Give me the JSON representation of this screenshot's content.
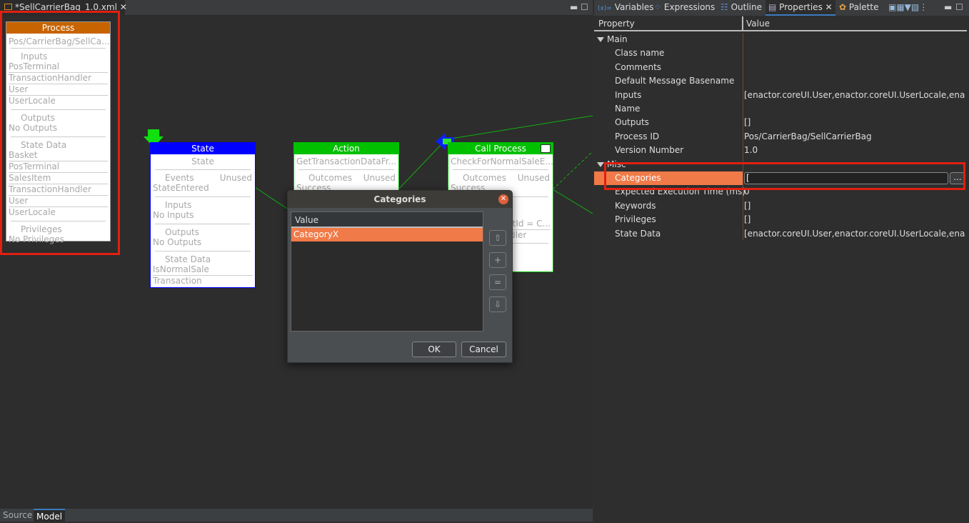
{
  "editor": {
    "tab_title": "*SellCarrierBag_1.0.xml",
    "bottom_tabs": [
      "Source",
      "Model"
    ],
    "active_bottom_tab": "Model"
  },
  "nodes": {
    "process": {
      "header": "Process",
      "header_color": "#c86400",
      "id": "Pos/CarrierBag/SellCa...",
      "inputs_label": "Inputs",
      "inputs": [
        "PosTerminal",
        "TransactionHandler",
        "User",
        "UserLocale"
      ],
      "outputs_label": "Outputs",
      "outputs_value": "No Outputs",
      "state_data_label": "State Data",
      "state_data": [
        "Basket",
        "PosTerminal",
        "SalesItem",
        "TransactionHandler",
        "User",
        "UserLocale"
      ],
      "privileges_label": "Privileges",
      "privileges_value": "No Privileges"
    },
    "state": {
      "header": "State",
      "header_color": "#0000ff",
      "name": "State",
      "events_label": "Events",
      "unused": "Unused",
      "event": "StateEntered",
      "inputs_label": "Inputs",
      "inputs_value": "No Inputs",
      "outputs_label": "Outputs",
      "outputs_value": "No Outputs",
      "state_data_label": "State Data",
      "state_data": [
        "IsNormalSale",
        "Transaction"
      ]
    },
    "action": {
      "header": "Action",
      "header_color": "#00c000",
      "name": "GetTransactionDataFr...",
      "outcomes_label": "Outcomes",
      "unused": "Unused",
      "outcome": "Success"
    },
    "call_process": {
      "header": "Call Process",
      "header_color": "#00c000",
      "name": "CheckForNormalSaleE...",
      "outcomes_label": "Outcomes",
      "unused": "Unused",
      "outcome": "Success",
      "line1": "ntId = C...",
      "line2": "dler"
    }
  },
  "dialog": {
    "title": "Categories",
    "column": "Value",
    "items": [
      "CategoryX"
    ],
    "selected_color": "#f07a48",
    "side_buttons": [
      "⇧",
      "+",
      "=",
      "⇩"
    ],
    "ok": "OK",
    "cancel": "Cancel"
  },
  "right_panel": {
    "tabs": [
      "Variables",
      "Expressions",
      "Outline",
      "Properties",
      "Palette"
    ],
    "active_tab": "Properties",
    "headers": [
      "Property",
      "Value"
    ],
    "groups": [
      {
        "name": "Main",
        "rows": [
          {
            "k": "Class name",
            "v": ""
          },
          {
            "k": "Comments",
            "v": ""
          },
          {
            "k": "Default Message Basename",
            "v": ""
          },
          {
            "k": "Inputs",
            "v": "[enactor.coreUI.User,enactor.coreUI.UserLocale,enactor"
          },
          {
            "k": "Name",
            "v": ""
          },
          {
            "k": "Outputs",
            "v": "[]"
          },
          {
            "k": "Process ID",
            "v": "Pos/CarrierBag/SellCarrierBag"
          },
          {
            "k": "Version Number",
            "v": "1.0"
          }
        ]
      },
      {
        "name": "Misc",
        "rows": [
          {
            "k": "Categories",
            "v": ""
          },
          {
            "k": "Expected Execution Time (ms)",
            "v": "0"
          },
          {
            "k": "Keywords",
            "v": "[]"
          },
          {
            "k": "Privileges",
            "v": "[]"
          },
          {
            "k": "State Data",
            "v": "[enactor.coreUI.User,enactor.coreUI.UserLocale,enactor"
          }
        ]
      }
    ],
    "categories_edit_value": "[",
    "browse_button": "...",
    "highlight_color": "#f07a48"
  }
}
